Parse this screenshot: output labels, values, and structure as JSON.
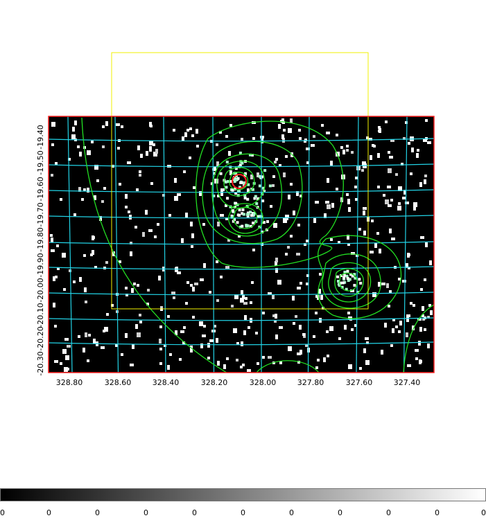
{
  "image": {
    "frame_color": "#ff2020",
    "background_color": "#000000",
    "grid_color": "#22d3e6",
    "contour_color": "#22dd22",
    "region_color": "#f2f200",
    "source_marker_color": "#ff2020"
  },
  "axes": {
    "ra_ticks": [
      "328.80",
      "328.60",
      "328.40",
      "328.20",
      "328.00",
      "327.80",
      "327.60",
      "327.40"
    ],
    "dec_ticks": [
      "-20.30",
      "-20.20",
      "-20.10",
      "-20.00",
      "-19.90",
      "-19.80",
      "-19.70",
      "-19.60",
      "-19.50",
      "-19.40"
    ]
  },
  "colorbar": {
    "gradient": [
      "#000000",
      "#ffffff"
    ],
    "labels": [
      "0",
      "0",
      "0",
      "0",
      "0",
      "0",
      "0",
      "0",
      "0",
      "0",
      "0"
    ]
  }
}
